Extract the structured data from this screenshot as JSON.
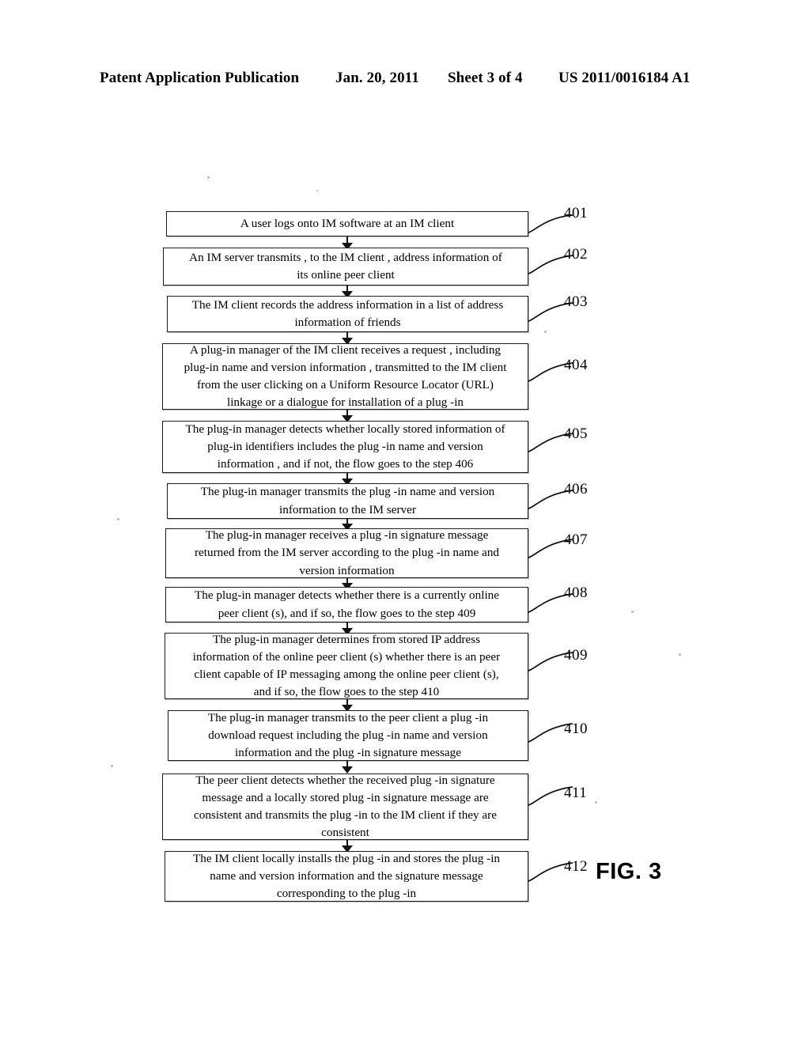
{
  "header": {
    "publication": "Patent Application Publication",
    "date": "Jan. 20, 2011",
    "sheet": "Sheet 3 of 4",
    "patent_number": "US 2011/0016184 A1"
  },
  "figure": {
    "label": "FIG. 3",
    "type": "flowchart",
    "orientation": "top-to-bottom",
    "connector": "downward-arrow"
  },
  "flowchart": {
    "nodes": [
      {
        "ref": "401",
        "text": "A user logs onto IM software at an IM client"
      },
      {
        "ref": "402",
        "text": "An IM server transmits , to the IM client , address information of\nits online peer client"
      },
      {
        "ref": "403",
        "text": "The IM client records the address information in a list of address\ninformation of friends"
      },
      {
        "ref": "404",
        "text": "A plug-in manager of the IM client receives a request , including\nplug-in name and version information , transmitted to the IM client\nfrom the user clicking on a Uniform Resource Locator  (URL)\nlinkage or a dialogue for installation of a plug  -in"
      },
      {
        "ref": "405",
        "text": "The plug-in manager detects whether locally stored information of\nplug-in identifiers includes the plug  -in name and version\ninformation , and if not, the flow goes to the step  406"
      },
      {
        "ref": "406",
        "text": "The plug-in manager transmits the plug  -in name and version\ninformation to the IM server"
      },
      {
        "ref": "407",
        "text": "The plug-in manager receives a plug  -in signature message\nreturned from the IM server according to the plug  -in name and\nversion information"
      },
      {
        "ref": "408",
        "text": "The plug-in manager detects whether there is a currently online\npeer client (s), and if so, the flow goes to the step  409"
      },
      {
        "ref": "409",
        "text": "The plug-in manager determines from stored IP address\ninformation of the online peer client  (s) whether there is an peer\nclient capable of IP messaging among the online peer client  (s),\nand if so, the flow goes to the step  410"
      },
      {
        "ref": "410",
        "text": "The plug-in manager transmits to the peer client a plug  -in\ndownload request including the plug  -in name and version\ninformation and the plug -in signature message"
      },
      {
        "ref": "411",
        "text": "The peer client detects whether the received plug  -in signature\nmessage and a locally stored plug  -in signature message are\nconsistent and transmits the plug  -in to the IM client if they are\nconsistent"
      },
      {
        "ref": "412",
        "text": "The IM client locally installs the plug  -in and stores the plug -in\nname and version information and the signature message\ncorresponding to the plug -in"
      }
    ]
  },
  "colors": {
    "ink": "#000000",
    "box_border": "#1d1d1d",
    "background": "#ffffff"
  }
}
